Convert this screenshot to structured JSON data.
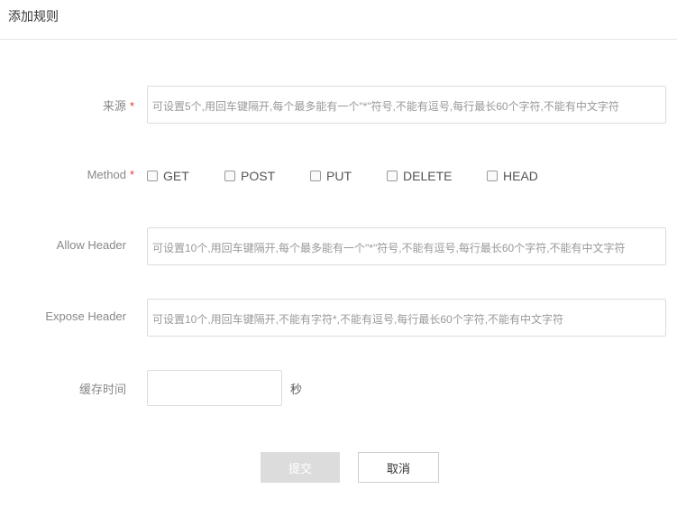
{
  "dialog": {
    "title": "添加规则"
  },
  "form": {
    "origin": {
      "label": "来源",
      "required_mark": "*",
      "placeholder": "可设置5个,用回车键隔开,每个最多能有一个\"*\"符号,不能有逗号,每行最长60个字符,不能有中文字符"
    },
    "method": {
      "label": "Method",
      "required_mark": "*",
      "options": [
        {
          "label": "GET",
          "checked": false
        },
        {
          "label": "POST",
          "checked": false
        },
        {
          "label": "PUT",
          "checked": false
        },
        {
          "label": "DELETE",
          "checked": false
        },
        {
          "label": "HEAD",
          "checked": false
        }
      ]
    },
    "allow_header": {
      "label": "Allow Header",
      "placeholder": "可设置10个,用回车键隔开,每个最多能有一个\"*\"符号,不能有逗号,每行最长60个字符,不能有中文字符"
    },
    "expose_header": {
      "label": "Expose Header",
      "placeholder": "可设置10个,用回车键隔开,不能有字符*,不能有逗号,每行最长60个字符,不能有中文字符"
    },
    "cache_time": {
      "label": "缓存时间",
      "value": "",
      "unit": "秒"
    }
  },
  "buttons": {
    "submit": "提交",
    "cancel": "取消"
  },
  "colors": {
    "required": "#e4393c",
    "submit_disabled_bg": "#dcdcdc",
    "border": "#dcdcdc"
  }
}
